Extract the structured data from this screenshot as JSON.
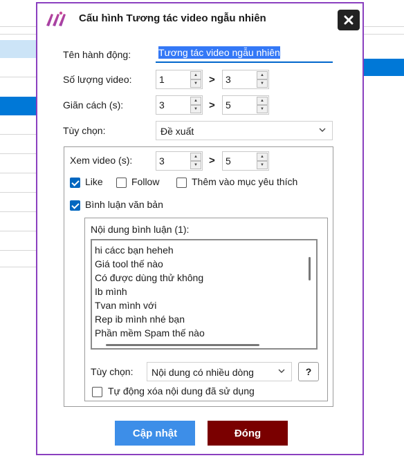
{
  "dialog": {
    "title": "Cấu hình Tương tác video ngẫu nhiên",
    "close_glyph": "✕"
  },
  "form": {
    "action_name_label": "Tên hành động:",
    "action_name_value": "Tương tác video ngẫu nhiên",
    "video_count_label": "Số lượng video:",
    "video_count_min": "1",
    "video_count_max": "3",
    "interval_label": "Giãn cách (s):",
    "interval_min": "3",
    "interval_max": "5",
    "options_label": "Tùy chọn:",
    "options_value": "Đề xuất",
    "range_separator": ">"
  },
  "group": {
    "watch_label": "Xem video (s):",
    "watch_min": "3",
    "watch_max": "5",
    "like_label": "Like",
    "like_checked": true,
    "follow_label": "Follow",
    "follow_checked": false,
    "favorite_label": "Thêm vào mục yêu thích",
    "favorite_checked": false,
    "comment_label": "Bình luận văn bản",
    "comment_checked": true
  },
  "comment_box": {
    "content_label": "Nội dung bình luận (1):",
    "lines": [
      "hi cácc bạn heheh",
      "Giá tool thế nào",
      "Có được dùng thử không",
      "Ib mình",
      "Tvan mình với",
      "Rep ib mình nhé bạn",
      "Phần mềm Spam thế nào"
    ],
    "options_label": "Tùy chọn:",
    "options_value": "Nội dung có nhiều dòng",
    "help_label": "?",
    "auto_delete_label": "Tự động xóa nội dung đã sử dụng",
    "auto_delete_checked": false
  },
  "buttons": {
    "update": "Cập nhật",
    "close": "Đóng"
  },
  "colors": {
    "dialog_border": "#8a3fbf",
    "update_button": "#3d8ee8",
    "close_button": "#7a0000",
    "checkbox_checked": "#0067c0",
    "text_highlight": "#3478f6"
  }
}
